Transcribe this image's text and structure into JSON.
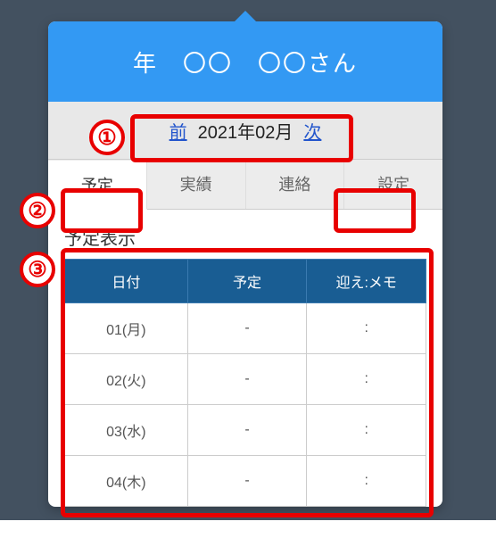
{
  "header": {
    "title": "年　〇〇　〇〇さん"
  },
  "month_nav": {
    "prev_label": "前",
    "current": "2021年02月",
    "next_label": "次"
  },
  "tabs": {
    "items": [
      {
        "label": "予定",
        "active": true
      },
      {
        "label": "実績",
        "active": false
      },
      {
        "label": "連絡",
        "active": false
      },
      {
        "label": "設定",
        "active": false
      }
    ]
  },
  "section_title": "予定表示",
  "table": {
    "headers": {
      "date": "日付",
      "plan": "予定",
      "memo": "迎え:メモ"
    },
    "rows": [
      {
        "date": "01(月)",
        "plan": "-",
        "memo": ":"
      },
      {
        "date": "02(火)",
        "plan": "-",
        "memo": ":"
      },
      {
        "date": "03(水)",
        "plan": "-",
        "memo": ":"
      },
      {
        "date": "04(木)",
        "plan": "-",
        "memo": ":"
      }
    ]
  },
  "annotations": {
    "one": "①",
    "two": "②",
    "three": "③"
  }
}
